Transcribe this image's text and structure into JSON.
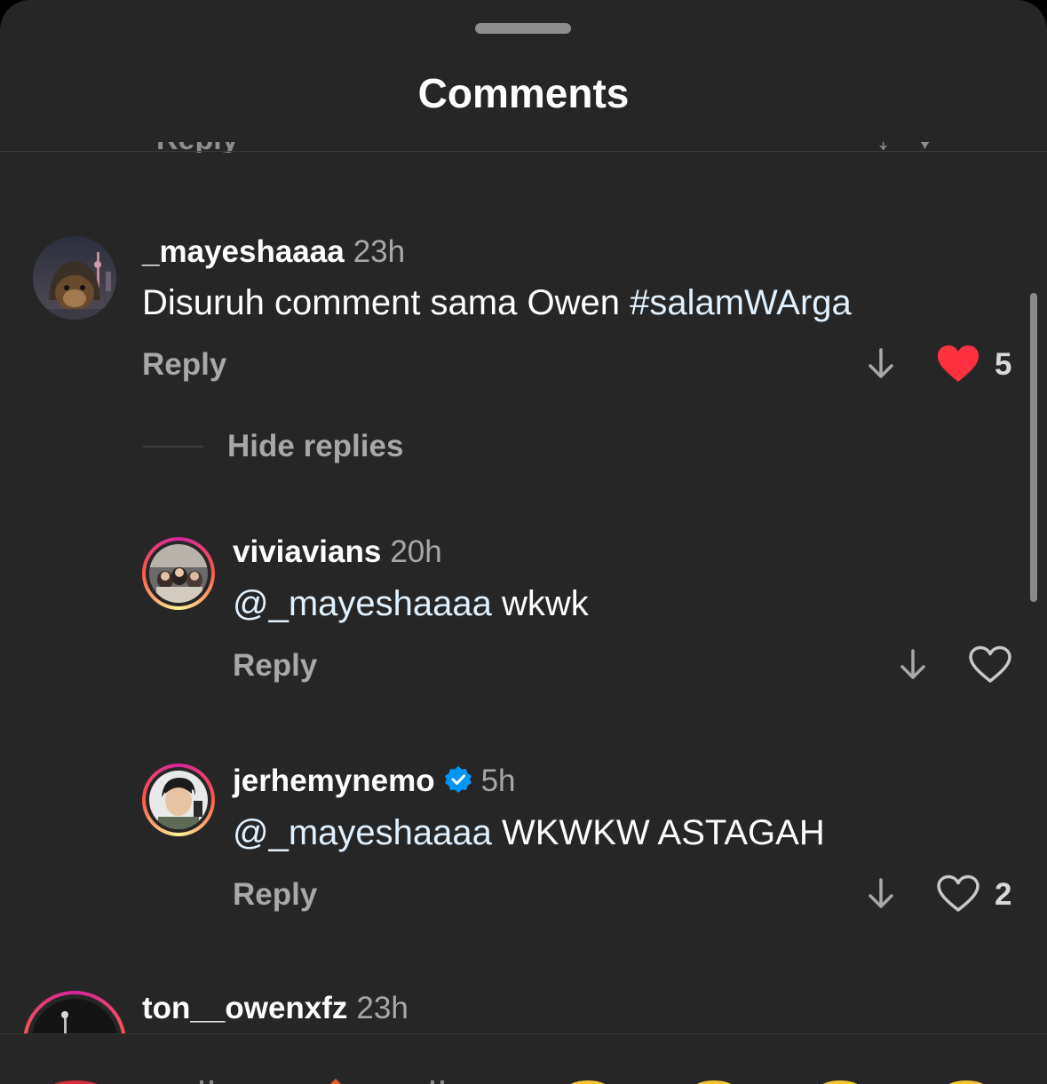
{
  "sheet": {
    "title": "Comments"
  },
  "comments": [
    {
      "username": "_mayeshaaaa",
      "time": "23h",
      "text": "Disuruh comment sama Owen ",
      "hashtag": "#salamWArga",
      "reply_label": "Reply",
      "likes": "5",
      "liked": true,
      "hide_replies_label": "Hide replies",
      "replies": [
        {
          "username": "viviavians",
          "time": "20h",
          "mention": "@_mayeshaaaa",
          "text": " wkwk",
          "reply_label": "Reply",
          "likes": "",
          "liked": false
        },
        {
          "username": "jerhemynemo",
          "verified": true,
          "time": "5h",
          "mention": "@_mayeshaaaa",
          "text": " WKWKW ASTAGAH",
          "reply_label": "Reply",
          "likes": "2",
          "liked": false
        }
      ]
    },
    {
      "username": "ton__owenxfz",
      "time": "23h"
    }
  ],
  "colors": {
    "like_red": "#ff3040",
    "verified_blue": "#0095f6",
    "background": "#262626"
  }
}
